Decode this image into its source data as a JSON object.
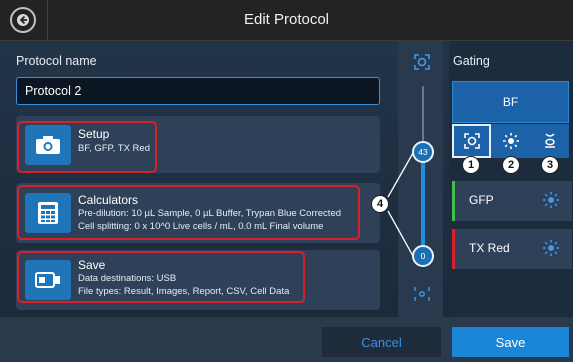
{
  "header": {
    "title": "Edit Protocol"
  },
  "protocol": {
    "name_label": "Protocol name",
    "name_value": "Protocol 2"
  },
  "cards": {
    "setup": {
      "title": "Setup",
      "lines": [
        "BF, GFP, TX Red"
      ]
    },
    "calculators": {
      "title": "Calculators",
      "lines": [
        "Pre-dilution: 10 µL Sample, 0 µL Buffer, Trypan Blue Corrected",
        "Cell splitting: 0 x 10^0 Live cells / mL, 0.0 mL Final volume"
      ]
    },
    "save": {
      "title": "Save",
      "lines": [
        "Data destinations: USB",
        "File types: Result, Images, Report, CSV, Cell Data"
      ]
    }
  },
  "slider": {
    "upper_value": "43",
    "lower_value": "0"
  },
  "gating": {
    "label": "Gating",
    "bf_label": "BF",
    "channels": [
      {
        "name": "GFP",
        "color": "#3fbf4a"
      },
      {
        "name": "TX Red",
        "color": "#d8202a"
      }
    ]
  },
  "callouts": [
    "1",
    "2",
    "3",
    "4"
  ],
  "footer": {
    "cancel_label": "Cancel",
    "save_label": "Save"
  },
  "colors": {
    "accent": "#1b86d8",
    "highlight": "#d8202a"
  },
  "icons": [
    "back-arrow-icon",
    "camera-icon",
    "calculator-icon",
    "usb-drive-icon",
    "focus-icon",
    "sun-icon",
    "gate-icon"
  ]
}
